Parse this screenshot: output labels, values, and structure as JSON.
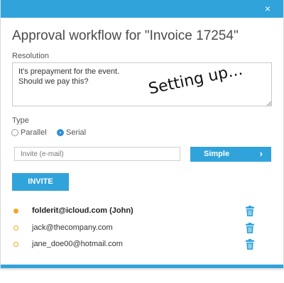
{
  "dialog": {
    "title": "Approval workflow for \"Invoice 17254\"",
    "close_glyph": "×",
    "accent_color": "#31a3db"
  },
  "resolution": {
    "label": "Resolution",
    "value": "It's prepayment for the event.\nShould we pay this?"
  },
  "overlay_text": "Setting up...",
  "type": {
    "label": "Type",
    "options": [
      {
        "label": "Parallel",
        "checked": false
      },
      {
        "label": "Serial",
        "checked": true
      }
    ]
  },
  "invite": {
    "placeholder": "Invite (e-mail)",
    "mode_label": "Simple",
    "mode_chevron": "›",
    "button_label": "INVITE"
  },
  "people": [
    {
      "email": "folderit@icloud.com (John)",
      "status": "filled",
      "bold": true
    },
    {
      "email": "jack@thecompany.com",
      "status": "hollow",
      "bold": false
    },
    {
      "email": "jane_doe00@hotmail.com",
      "status": "hollow",
      "bold": false
    }
  ],
  "icons": {
    "close": "close-icon",
    "chevron": "chevron-right-icon",
    "trash": "trash-icon"
  }
}
